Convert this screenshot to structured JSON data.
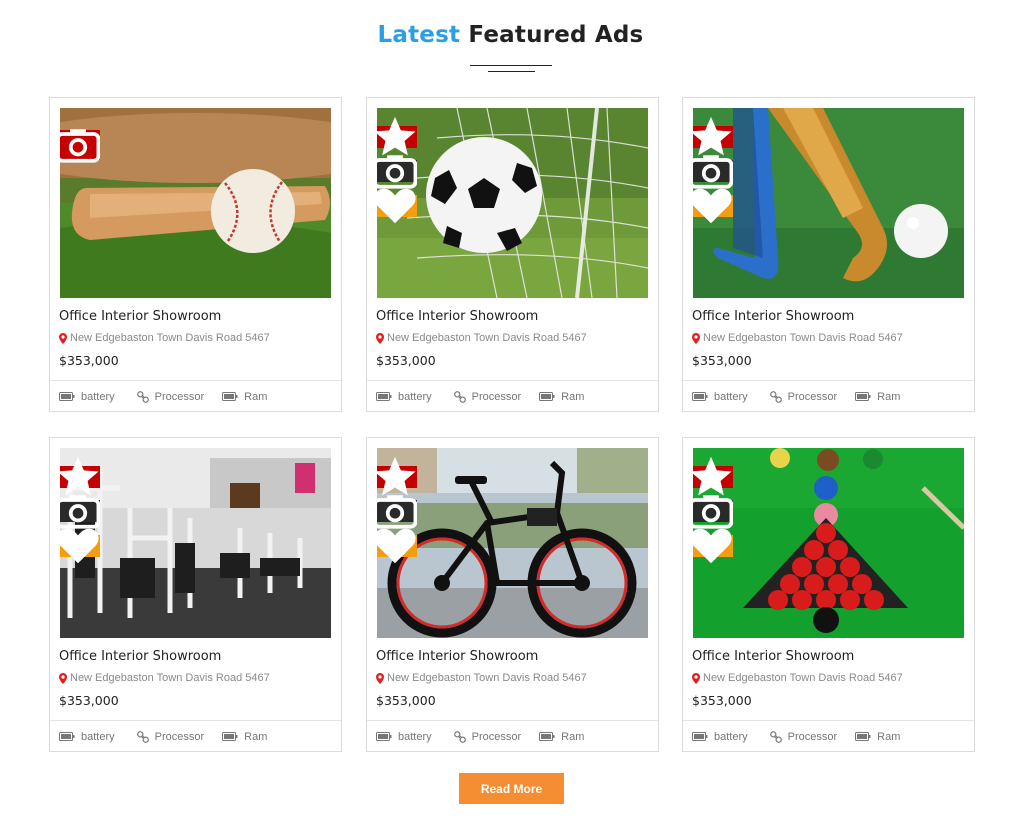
{
  "section": {
    "title_accent": "Latest",
    "title_rest": "Featured Ads"
  },
  "cards": [
    {
      "title": "Office Interior Showroom",
      "location": "New Edgebaston Town Davis Road 5467",
      "price": "$353,000",
      "image": "baseball-bat-and-ball",
      "badges": [
        "camera-icon"
      ]
    },
    {
      "title": "Office Interior Showroom",
      "location": "New Edgebaston Town Davis Road 5467",
      "price": "$353,000",
      "image": "soccer-ball-in-net",
      "badges": [
        "star-icon",
        "camera-icon",
        "heart-icon"
      ]
    },
    {
      "title": "Office Interior Showroom",
      "location": "New Edgebaston Town Davis Road 5467",
      "price": "$353,000",
      "image": "hockey-stick-and-ball",
      "badges": [
        "star-icon",
        "camera-icon",
        "heart-icon"
      ]
    },
    {
      "title": "Office Interior Showroom",
      "location": "New Edgebaston Town Davis Road 5467",
      "price": "$353,000",
      "image": "gym-equipment",
      "badges": [
        "star-icon",
        "camera-icon",
        "heart-icon"
      ]
    },
    {
      "title": "Office Interior Showroom",
      "location": "New Edgebaston Town Davis Road 5467",
      "price": "$353,000",
      "image": "mountain-bicycle",
      "badges": [
        "star-icon",
        "camera-icon",
        "heart-icon"
      ]
    },
    {
      "title": "Office Interior Showroom",
      "location": "New Edgebaston Town Davis Road 5467",
      "price": "$353,000",
      "image": "snooker-table",
      "badges": [
        "star-icon",
        "camera-icon",
        "heart-icon"
      ]
    }
  ],
  "features": [
    {
      "label": "battery",
      "icon": "battery-icon"
    },
    {
      "label": "Processor",
      "icon": "link-icon"
    },
    {
      "label": "Ram",
      "icon": "ram-icon"
    }
  ],
  "read_more_label": "Read More",
  "colors": {
    "accent_blue": "#2c9ee3",
    "star_badge": "#c40000",
    "camera_badge": "#2a2a2a",
    "heart_badge": "#f49d0e",
    "button": "#f58d32"
  }
}
